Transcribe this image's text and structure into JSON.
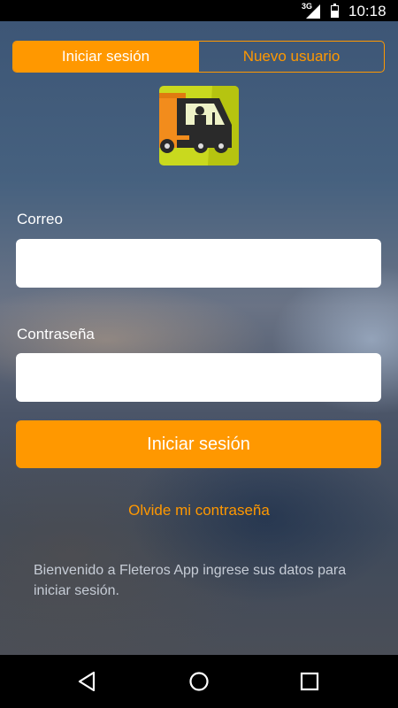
{
  "status_bar": {
    "network": "3G",
    "time": "10:18"
  },
  "tabs": [
    {
      "label": "Iniciar sesión",
      "active": true
    },
    {
      "label": "Nuevo usuario",
      "active": false
    }
  ],
  "logo": {
    "icon": "delivery-truck-driver-icon"
  },
  "form": {
    "email_label": "Correo",
    "email_value": "",
    "password_label": "Contraseña",
    "password_value": "",
    "submit_label": "Iniciar sesión",
    "forgot_label": "Olvide mi contraseña"
  },
  "welcome_text": "Bienvenido a Fleteros App ingrese sus datos para iniciar sesión.",
  "nav": {
    "back": "back-icon",
    "home": "home-icon",
    "recents": "recents-icon"
  },
  "colors": {
    "accent": "#ff9800",
    "bar": "#000000"
  }
}
